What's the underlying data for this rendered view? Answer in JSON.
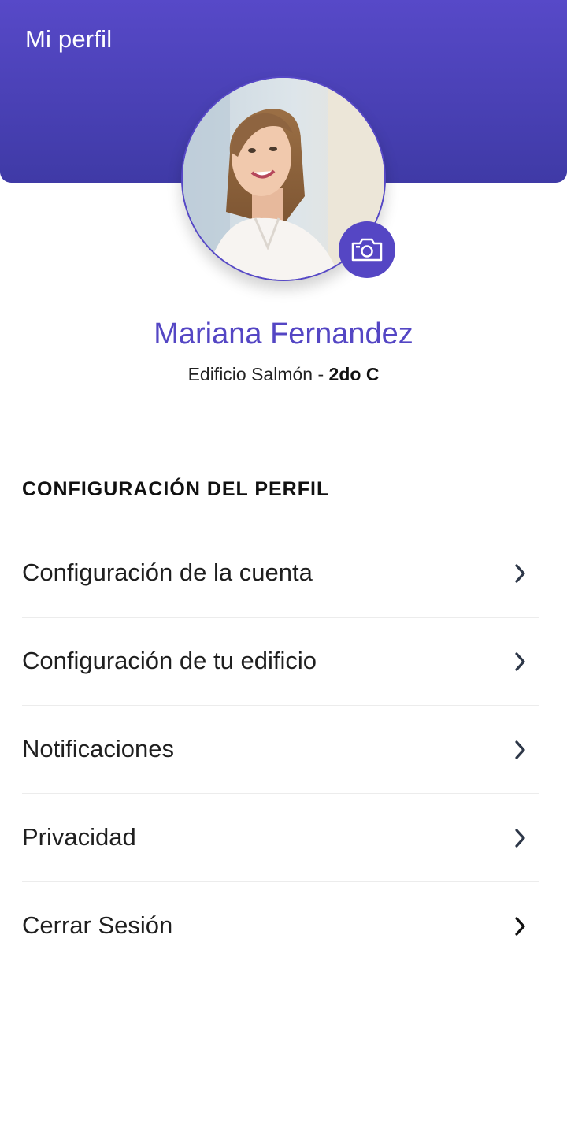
{
  "header": {
    "title": "Mi perfil",
    "background": "#4f44c0"
  },
  "profile": {
    "name": "Mariana Fernandez",
    "building": "Edificio Salmón",
    "separator": " - ",
    "unit": "2do C",
    "name_color": "#5446c4",
    "avatar_icon": "avatar-photo",
    "camera_icon": "camera-icon"
  },
  "section": {
    "title": "CONFIGURACIÓN DEL PERFIL"
  },
  "menu": {
    "items": [
      {
        "label": "Configuración de la cuenta",
        "icon": "chevron-right-icon",
        "icon_color": "#2d3748"
      },
      {
        "label": "Configuración de tu edificio",
        "icon": "chevron-right-icon",
        "icon_color": "#2d3748"
      },
      {
        "label": "Notificaciones",
        "icon": "chevron-right-icon",
        "icon_color": "#2d3748"
      },
      {
        "label": "Privacidad",
        "icon": "chevron-right-icon",
        "icon_color": "#2d3748"
      },
      {
        "label": "Cerrar Sesión",
        "icon": "chevron-right-icon",
        "icon_color": "#111111"
      }
    ]
  }
}
